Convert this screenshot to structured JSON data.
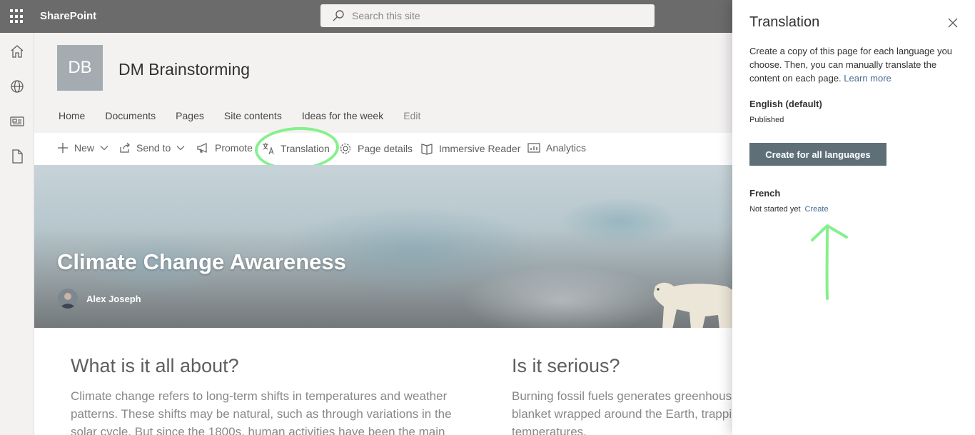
{
  "suitebar": {
    "app_name": "SharePoint",
    "search_placeholder": "Search this site"
  },
  "leftrail": {
    "items": [
      "home-icon",
      "globe-icon",
      "news-icon",
      "page-icon"
    ]
  },
  "site": {
    "logo_initials": "DB",
    "title": "DM Brainstorming",
    "nav": [
      "Home",
      "Documents",
      "Pages",
      "Site contents",
      "Ideas for the week",
      "Edit"
    ]
  },
  "commandbar": {
    "new": "New",
    "send_to": "Send to",
    "promote": "Promote",
    "translation": "Translation",
    "page_details": "Page details",
    "immersive_reader": "Immersive Reader",
    "analytics": "Analytics"
  },
  "hero": {
    "title": "Climate Change Awareness",
    "author": "Alex Joseph"
  },
  "content": {
    "col1_heading": "What is it all about?",
    "col1_text": "Climate change refers to long-term shifts in temperatures and weather patterns. These shifts may be natural, such as through variations in the solar cycle. But since the 1800s, human activities have been the main",
    "col2_heading": "Is it serious?",
    "col2_text": "Burning fossil fuels generates greenhouse gas emissions that act like a blanket wrapped around the Earth, trapping the sun's heat and raising temperatures."
  },
  "panel": {
    "title": "Translation",
    "description": "Create a copy of this page for each language you choose. Then, you can manually translate the content on each page.",
    "learn_more": "Learn more",
    "default_lang": "English (default)",
    "default_status": "Published",
    "create_all_button": "Create for all languages",
    "french_lang": "French",
    "french_status": "Not started yet",
    "french_create": "Create"
  },
  "colors": {
    "suitebar": "#6b6b6b",
    "annotation": "#86f08d",
    "link": "#47698f",
    "primary_button": "#5f6f78"
  }
}
